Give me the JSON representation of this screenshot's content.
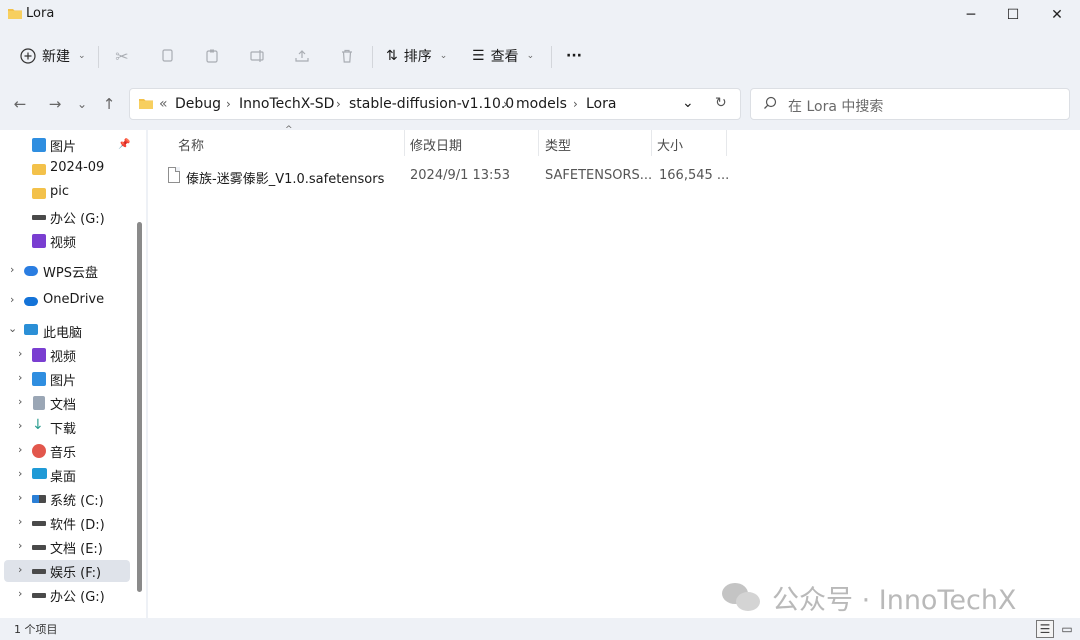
{
  "window": {
    "title": "Lora",
    "minimize": "─",
    "maximize": "☐",
    "close": "✕"
  },
  "commandbar": {
    "new_label": "新建",
    "sort_label": "排序",
    "view_label": "查看",
    "more": "···"
  },
  "nav": {
    "back": "←",
    "forward": "→",
    "recent": "⌄",
    "up": "↑",
    "breadcrumb_overflow": "«",
    "breadcrumb": [
      "Debug",
      "InnoTechX-SD",
      "stable-diffusion-v1.10.0",
      "models",
      "Lora"
    ],
    "dropdown": "⌄",
    "refresh": "↻"
  },
  "search": {
    "placeholder": "在 Lora 中搜索"
  },
  "sidebar": {
    "quick_access": [
      {
        "label": "图片",
        "icon": "pictures-icon"
      },
      {
        "label": "2024-09",
        "icon": "folder-icon"
      },
      {
        "label": "pic",
        "icon": "folder-icon"
      },
      {
        "label": "办公 (G:)",
        "icon": "drive-icon"
      },
      {
        "label": "视频",
        "icon": "videos-icon"
      }
    ],
    "wps_cloud": "WPS云盘",
    "onedrive": "OneDrive",
    "this_pc": "此电脑",
    "pc_items": [
      {
        "label": "视频",
        "icon": "videos-icon"
      },
      {
        "label": "图片",
        "icon": "pictures-icon"
      },
      {
        "label": "文档",
        "icon": "documents-icon"
      },
      {
        "label": "下载",
        "icon": "download-icon"
      },
      {
        "label": "音乐",
        "icon": "music-icon"
      },
      {
        "label": "桌面",
        "icon": "desktop-icon"
      },
      {
        "label": "系统 (C:)",
        "icon": "windows-drive-icon"
      },
      {
        "label": "软件 (D:)",
        "icon": "drive-icon"
      },
      {
        "label": "文档 (E:)",
        "icon": "drive-icon"
      },
      {
        "label": "娱乐 (F:)",
        "icon": "drive-icon",
        "selected": true
      },
      {
        "label": "办公 (G:)",
        "icon": "drive-icon"
      }
    ]
  },
  "columns": {
    "name": "名称",
    "modified": "修改日期",
    "type": "类型",
    "size": "大小"
  },
  "files": [
    {
      "name": "傣族-迷雾傣影_V1.0.safetensors",
      "modified": "2024/9/1 13:53",
      "type": "SAFETENSORS...",
      "size": "166,545 ..."
    }
  ],
  "status": {
    "item_count": "1 个项目"
  },
  "watermark": {
    "text": "公众号 · InnoTechX"
  },
  "colors": {
    "accent": "#0067c0",
    "folder": "#f3c14a",
    "selection": "#dfe3ea"
  }
}
